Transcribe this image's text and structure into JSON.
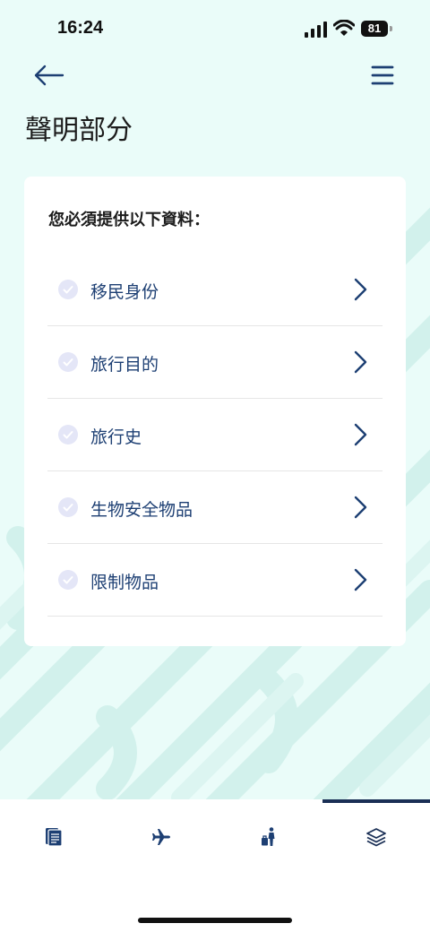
{
  "status_bar": {
    "time": "16:24",
    "battery": "81"
  },
  "page": {
    "title": "聲明部分"
  },
  "card": {
    "heading": "您必須提供以下資料：",
    "items": [
      {
        "label": "移民身份"
      },
      {
        "label": "旅行目的"
      },
      {
        "label": "旅行史"
      },
      {
        "label": "生物安全物品"
      },
      {
        "label": "限制物品"
      }
    ]
  },
  "tabs": [
    {
      "icon": "document-icon",
      "selected": false
    },
    {
      "icon": "airplane-icon",
      "selected": false
    },
    {
      "icon": "traveler-luggage-icon",
      "selected": false
    },
    {
      "icon": "layers-icon",
      "selected": true
    }
  ],
  "colors": {
    "background": "#eafcf9",
    "pattern": "#d4f2ed",
    "accent": "#1d3f73",
    "check": "#e4e6f7"
  }
}
